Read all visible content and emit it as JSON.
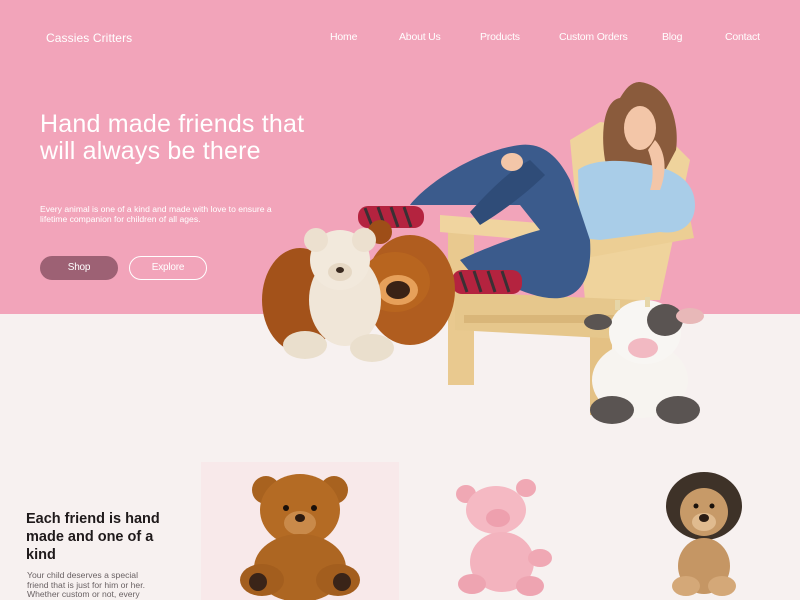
{
  "brand": {
    "name": "Cassies Critters"
  },
  "nav": {
    "items": [
      {
        "id": "home",
        "label": "Home"
      },
      {
        "id": "about",
        "label": "About Us"
      },
      {
        "id": "products",
        "label": "Products"
      },
      {
        "id": "custom",
        "label": "Custom Orders"
      },
      {
        "id": "blog",
        "label": "Blog"
      },
      {
        "id": "contact",
        "label": "Contact"
      }
    ]
  },
  "hero": {
    "headline": "Hand made friends that will always be there",
    "subtext": "Every animal is one of a kind and made with love to ensure a lifetime companion for children of all ages.",
    "shop_label": "Shop",
    "explore_label": "Explore"
  },
  "section2": {
    "title": "Each friend is hand made and one of a kind",
    "body": "Your child deserves a special friend that is just for him or her. Whether custom or not, every"
  },
  "colors": {
    "hero_bg": "#f2a4ba",
    "page_bg": "#f7f1f0",
    "shop_button": "#9d6174",
    "card_bg": "#f8e9ea"
  },
  "icons": [
    "teddy-bears-image",
    "woman-in-chair-image",
    "cow-plush-image",
    "brown-bear-plush-image",
    "pink-pig-plush-image",
    "lion-plush-image"
  ]
}
